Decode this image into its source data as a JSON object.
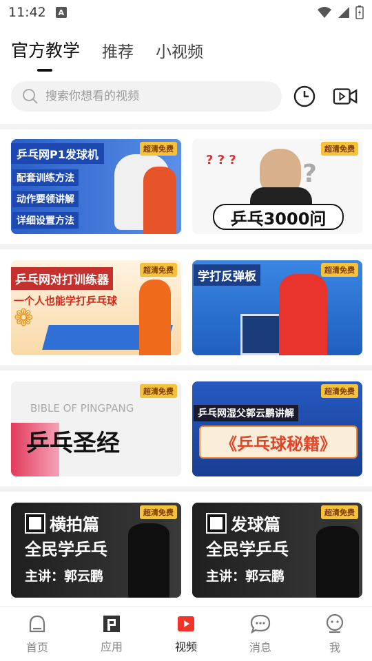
{
  "status": {
    "time": "11:42",
    "badge": "A"
  },
  "tabs": [
    {
      "label": "官方教学",
      "active": true
    },
    {
      "label": "推荐",
      "active": false
    },
    {
      "label": "小视频",
      "active": false
    }
  ],
  "search": {
    "placeholder": "搜索你想看的视频"
  },
  "badge_text": "超清免费",
  "cards": [
    {
      "title": "乒乓网P1发球机",
      "lines": [
        "配套训练方法",
        "动作要领讲解",
        "详细设置方法"
      ]
    },
    {
      "title": "乒乓3000问"
    },
    {
      "title": "乒乓网对打训练器",
      "subtitle": "一个人也能学打乒乓球"
    },
    {
      "title": "学打反弹板"
    },
    {
      "title": "乒乓圣经",
      "eng": "BIBLE OF PINGPANG"
    },
    {
      "title": "《乒乓球秘籍》",
      "subtitle": "乒乓网湿父郭云鹏讲解"
    },
    {
      "title": "横拍篇",
      "line2": "全民学乒乓",
      "line3": "主讲：郭云鹏"
    },
    {
      "title": "发球篇",
      "line2": "全民学乒乓",
      "line3": "主讲：郭云鹏"
    }
  ],
  "nav": [
    {
      "label": "首页",
      "icon": "home-icon"
    },
    {
      "label": "应用",
      "icon": "apps-icon"
    },
    {
      "label": "视频",
      "icon": "video-icon",
      "active": true
    },
    {
      "label": "消息",
      "icon": "message-icon"
    },
    {
      "label": "我",
      "icon": "profile-icon"
    }
  ],
  "colors": {
    "accent": "#f0342a",
    "badge": "#f6c23a",
    "blue": "#2f6fd6"
  }
}
